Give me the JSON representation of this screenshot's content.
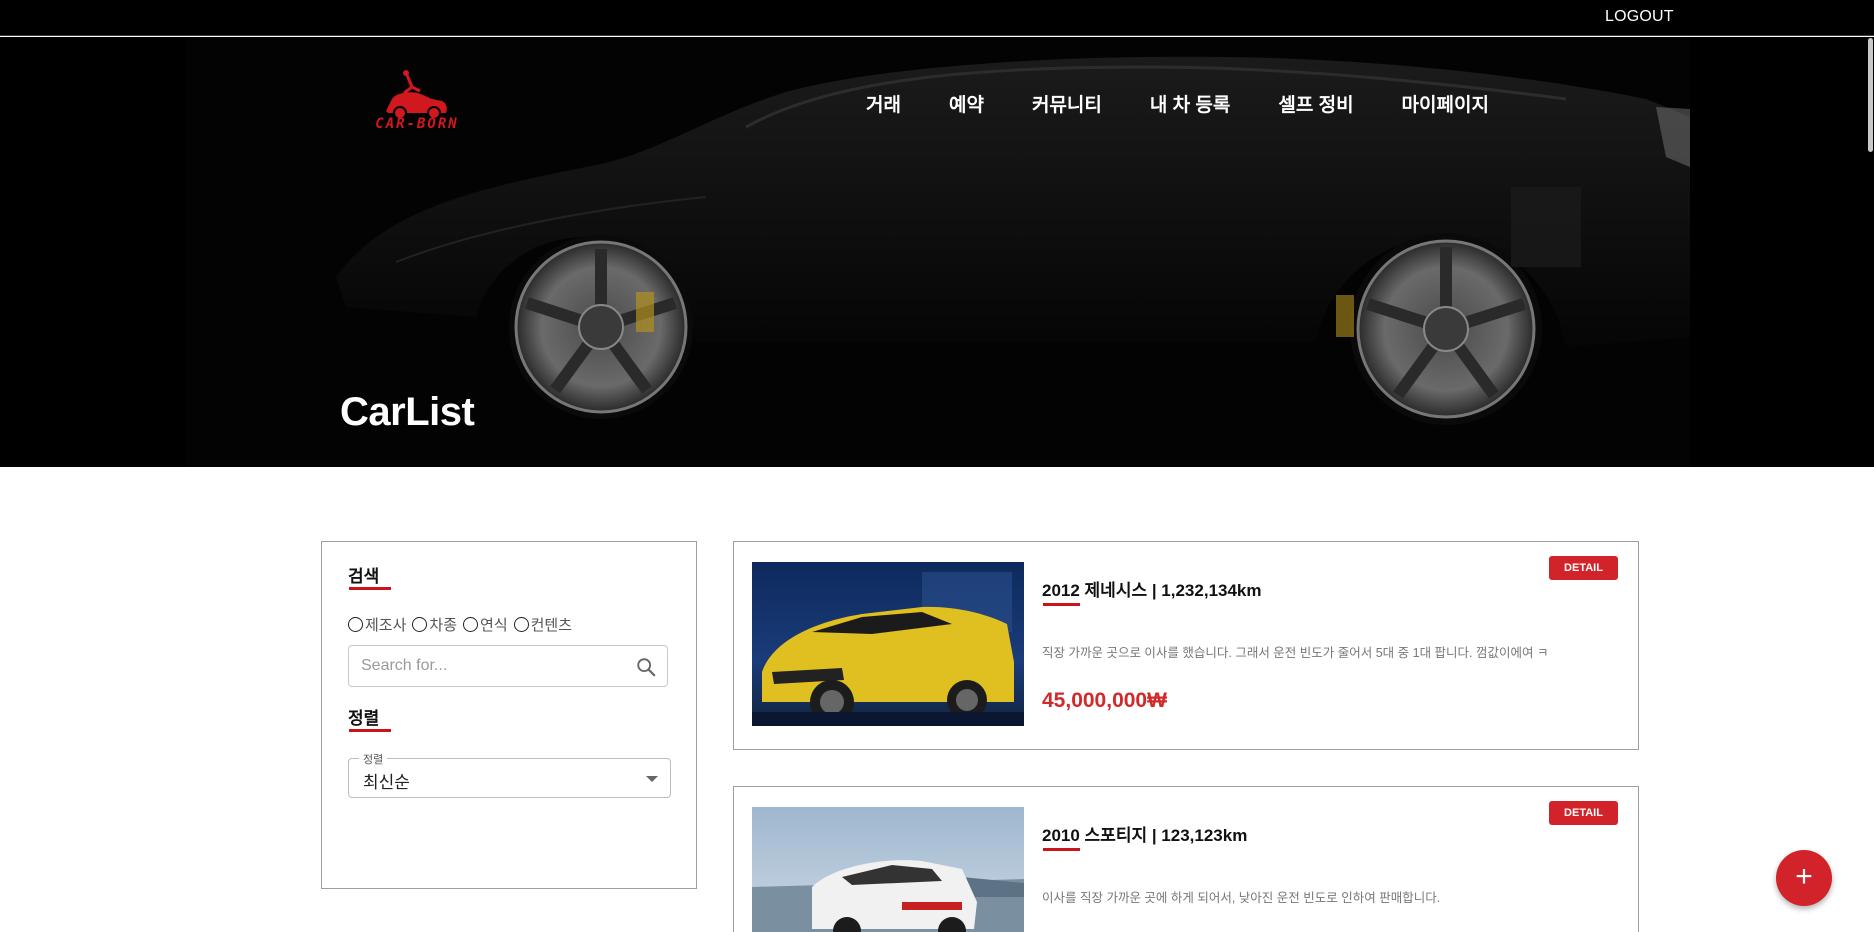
{
  "topbar": {
    "logout_label": "LOGOUT"
  },
  "header": {
    "logo_text": "CAR-BORN",
    "nav": [
      "거래",
      "예약",
      "커뮤니티",
      "내 차 등록",
      "셀프 정비",
      "마이페이지"
    ],
    "hero_title": "CarList"
  },
  "sidebar": {
    "search_title": "검색",
    "radio_options": [
      "제조사",
      "차종",
      "연식",
      "컨텐츠"
    ],
    "search_placeholder": "Search for...",
    "sort_title": "정렬",
    "sort_label": "정렬",
    "sort_value": "최신순"
  },
  "cards": [
    {
      "title": "2012 제네시스 | 1,232,134km",
      "description": "직장 가까운 곳으로 이사를 했습니다. 그래서 운전 빈도가 줄어서 5대 중 1대 팝니다. 껌값이에여 ㅋ",
      "price": "45,000,000₩",
      "detail_label": "DETAIL",
      "image": "yellow-suv-photo"
    },
    {
      "title": "2010 스포티지 | 123,123km",
      "description": "이사를 직장 가까운 곳에 하게 되어서, 낮아진 운전 빈도로 인하여 판매합니다.",
      "price": "",
      "detail_label": "DETAIL",
      "image": "white-suv-photo"
    }
  ],
  "fab": {
    "label": "+"
  },
  "colors": {
    "accent": "#d3232a",
    "hero_bg": "#000000",
    "price": "#d22a2a"
  }
}
